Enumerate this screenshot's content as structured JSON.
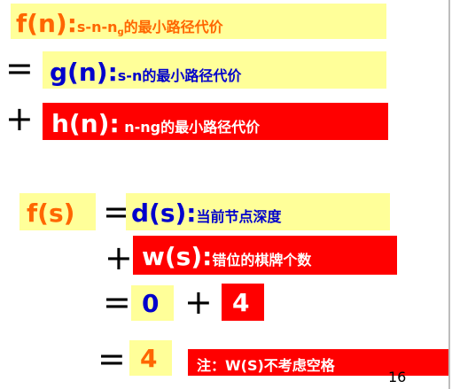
{
  "row1": {
    "label": "f(n):",
    "text_before_sub": "s-n-n",
    "subscript": "g",
    "text_after_sub": "的最小路径代价"
  },
  "row2": {
    "operator": "=",
    "label": "g(n):",
    "text": "s-n的最小路径代价"
  },
  "row3": {
    "operator": "+",
    "label": "h(n):",
    "text": " n-ng的最小路径代价"
  },
  "row4": {
    "term": "f(s)",
    "operator": "=",
    "label": "d(s):",
    "text": "当前节点深度"
  },
  "row5": {
    "operator": "+",
    "label": "w(s):",
    "text": "错位的棋牌个数"
  },
  "row6": {
    "operator_eq": "=",
    "value_a": "0",
    "operator_plus": "+",
    "value_b": "4"
  },
  "row7": {
    "operator": "=",
    "value": "4",
    "note": "注：W(S)不考虑空格"
  },
  "slide_number": "16",
  "colors": {
    "yellow_box": "#ffff99",
    "red_box": "#ff0000",
    "orange_text": "#ff6600",
    "blue_text": "#0000cc"
  }
}
